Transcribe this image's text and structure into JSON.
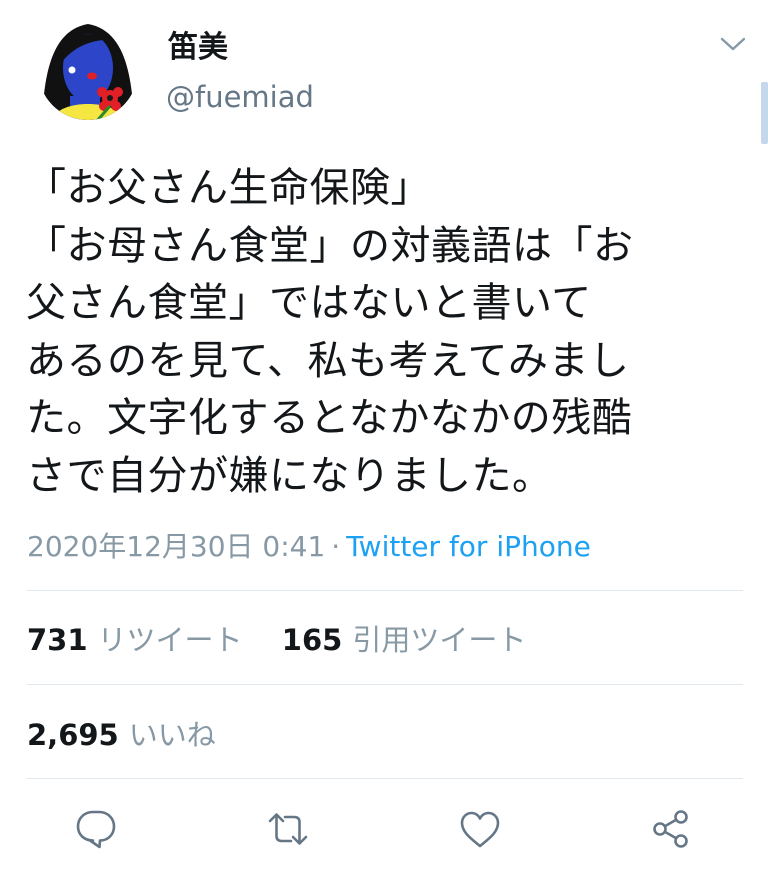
{
  "author": {
    "name": "笛美",
    "handle": "@fuemiad"
  },
  "tweet": {
    "lines": [
      "「お父さん生命保険」",
      "「お母さん食堂」の対義語は「お",
      "父さん食堂」ではないと書いて",
      "あるのを見て、私も考えてみまし",
      "た。文字化するとなかなかの残酷",
      "さで自分が嫌になりました。"
    ],
    "timestamp": "2020年12月30日 0:41",
    "separator": "·",
    "source": "Twitter for iPhone"
  },
  "stats": {
    "retweets_count": "731",
    "retweets_label": "リツイート",
    "quotes_count": "165",
    "quotes_label": "引用ツイート",
    "likes_count": "2,695",
    "likes_label": "いいね"
  },
  "icons": {
    "caret": "chevron-down-icon",
    "reply": "reply-icon",
    "retweet": "retweet-icon",
    "like": "heart-icon",
    "share": "share-icon"
  },
  "colors": {
    "link": "#1da1f2",
    "muted": "#8899a6",
    "text": "#14171a",
    "divider": "#e1e8ed"
  }
}
